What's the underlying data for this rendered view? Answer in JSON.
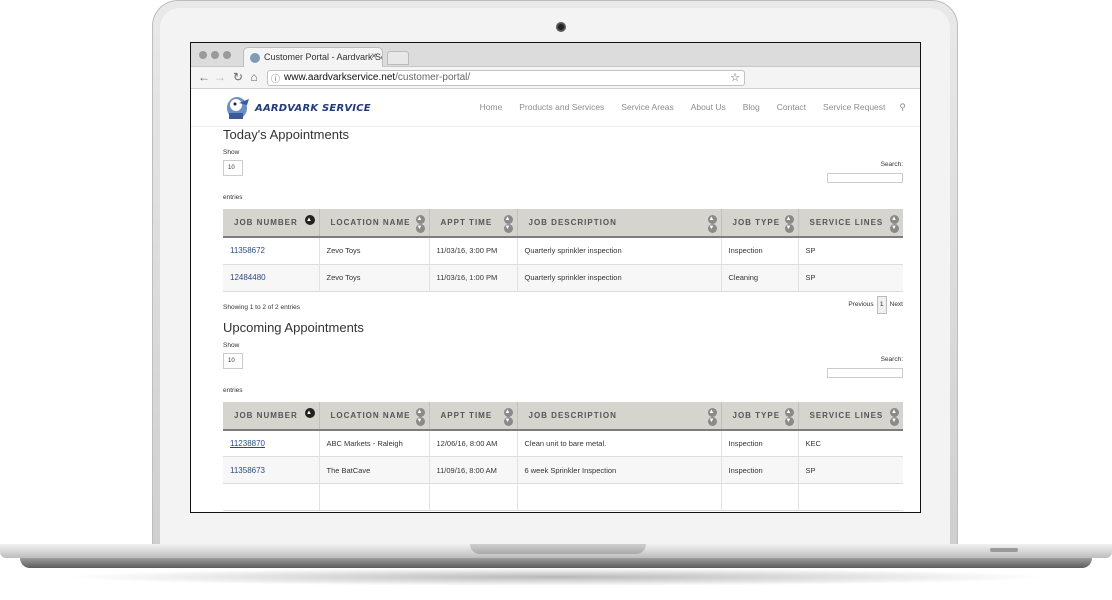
{
  "browser": {
    "tab_title": "Customer Portal - Aardvark Se",
    "url_domain": "www.aardvarkservice.net",
    "url_path": "/customer-portal/"
  },
  "site": {
    "logo_text": "AARDVARK SERVICE",
    "nav": [
      "Home",
      "Products and Services",
      "Service Areas",
      "About Us",
      "Blog",
      "Contact",
      "Service Request"
    ]
  },
  "today": {
    "title": "Today's Appointments",
    "show_label": "Show",
    "show_value": "10",
    "entries_label": "entries",
    "search_label": "Search:",
    "headers": [
      "JOB NUMBER",
      "LOCATION NAME",
      "APPT TIME",
      "JOB DESCRIPTION",
      "JOB TYPE",
      "SERVICE LINES"
    ],
    "rows": [
      [
        "11358672",
        "Zevo Toys",
        "11/03/16, 3:00 PM",
        "Quarterly sprinkler inspection",
        "Inspection",
        "SP"
      ],
      [
        "12484480",
        "Zevo Toys",
        "11/03/16, 1:00 PM",
        "Quarterly sprinkler inspection",
        "Cleaning",
        "SP"
      ]
    ],
    "info": "Showing 1 to 2 of 2 entries",
    "pager": {
      "previous": "Previous",
      "page": "1",
      "next": "Next"
    }
  },
  "upcoming": {
    "title": "Upcoming Appointments",
    "show_label": "Show",
    "show_value": "10",
    "entries_label": "entries",
    "search_label": "Search:",
    "headers": [
      "JOB NUMBER",
      "LOCATION NAME",
      "APPT TIME",
      "JOB DESCRIPTION",
      "JOB TYPE",
      "SERVICE LINES"
    ],
    "rows": [
      [
        "11238870",
        "ABC Markets - Raleigh",
        "12/06/16, 8:00 AM",
        "Clean unit to bare metal.",
        "Inspection",
        "KEC"
      ],
      [
        "11358673",
        "The BatCave",
        "11/09/16, 8:00 AM",
        "6 week Sprinkler Inspection",
        "Inspection",
        "SP"
      ]
    ]
  }
}
